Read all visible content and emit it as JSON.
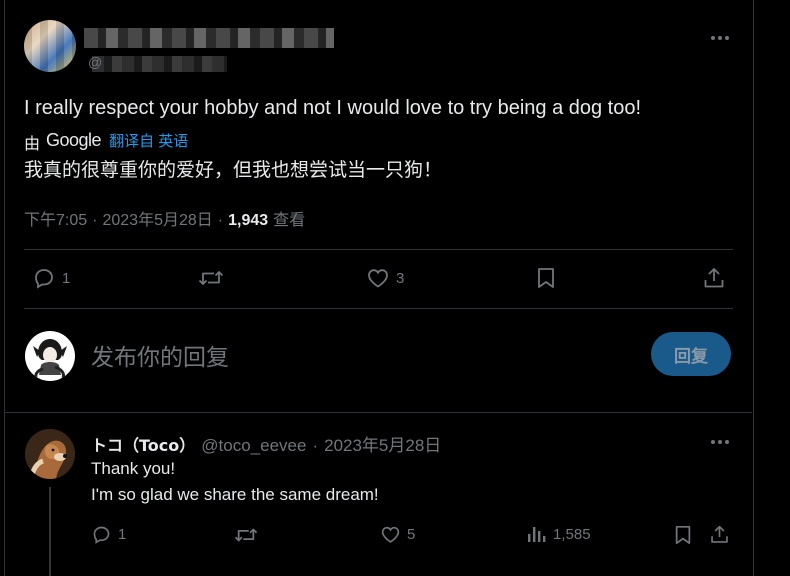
{
  "main_tweet": {
    "text": "I really respect your hobby and not I would love to try being a dog too!",
    "translation_prefix": "由",
    "translation_provider": "Google",
    "translation_action": "翻译自 英语",
    "translated_text": "我真的很尊重你的爱好，但我也想尝试当一只狗！",
    "time": "下午7:05",
    "date": "2023年5月28日",
    "separator": "·",
    "views_count": "1,943",
    "views_label": "查看",
    "reply_count": "1",
    "like_count": "3"
  },
  "composer": {
    "placeholder": "发布你的回复",
    "reply_button": "回复"
  },
  "reply_tweet": {
    "display_name": "トコ（Toco）",
    "handle": "@toco_eevee",
    "separator": "·",
    "date": "2023年5月28日",
    "line1": "Thank you!",
    "line2": "I'm so glad we share the same dream!",
    "reply_count": "1",
    "like_count": "5",
    "views_count": "1,585"
  },
  "colors": {
    "background": "#000000",
    "text": "#e7e9ea",
    "muted": "#71767b",
    "link": "#1d9bf0",
    "button_bg": "#1a5a8a",
    "border": "#2f3336"
  },
  "icons": [
    "more-icon",
    "reply-icon",
    "retweet-icon",
    "like-icon",
    "bookmark-icon",
    "share-icon",
    "views-icon"
  ]
}
